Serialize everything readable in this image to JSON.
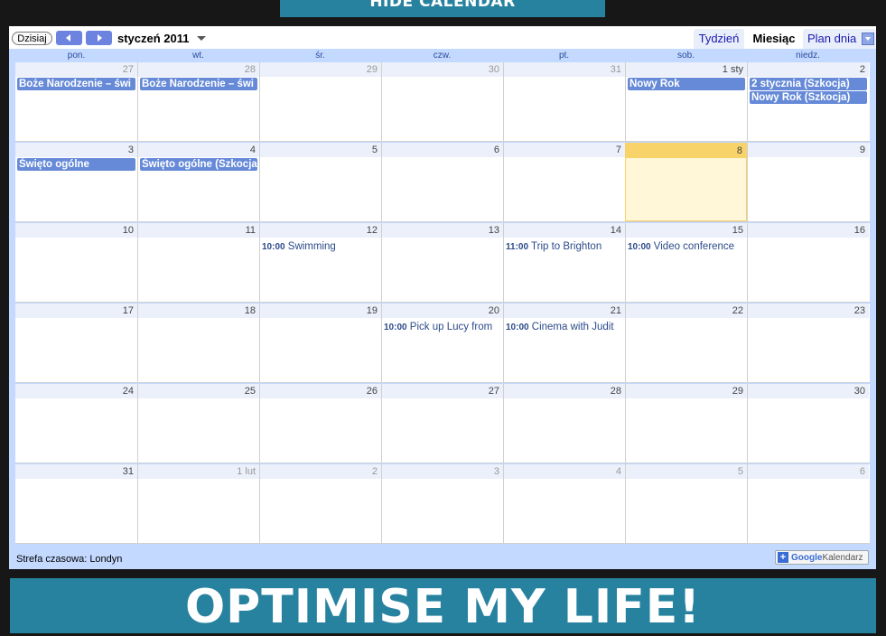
{
  "top_button": {
    "label": "HIDE CALENDAR"
  },
  "toolbar": {
    "today_label": "Dzisiaj",
    "month_title": "styczeń 2011",
    "tabs": {
      "week": "Tydzień",
      "month": "Miesiąc",
      "agenda": "Plan dnia"
    }
  },
  "weekdays": [
    "pon.",
    "wt.",
    "śr.",
    "czw.",
    "pt.",
    "sob.",
    "niedz."
  ],
  "weeks": [
    {
      "days": [
        {
          "label": "27",
          "other": true,
          "events": [
            {
              "kind": "allday",
              "title": "Boże Narodzenie – świ"
            }
          ]
        },
        {
          "label": "28",
          "other": true,
          "events": [
            {
              "kind": "allday",
              "title": "Boże Narodzenie – świ"
            }
          ]
        },
        {
          "label": "29",
          "other": true,
          "events": []
        },
        {
          "label": "30",
          "other": true,
          "events": []
        },
        {
          "label": "31",
          "other": true,
          "events": []
        },
        {
          "label": "1 sty",
          "other": false,
          "events": [
            {
              "kind": "allday",
              "title": "Nowy Rok"
            }
          ]
        },
        {
          "label": "2",
          "other": false,
          "events": [
            {
              "kind": "allday",
              "title": "2 stycznia (Szkocja)"
            },
            {
              "kind": "allday",
              "title": "Nowy Rok (Szkocja)"
            }
          ]
        }
      ]
    },
    {
      "days": [
        {
          "label": "3",
          "events": [
            {
              "kind": "allday",
              "title": "Święto ogólne"
            }
          ]
        },
        {
          "label": "4",
          "events": [
            {
              "kind": "allday",
              "title": "Święto ogólne (Szkocja)"
            }
          ]
        },
        {
          "label": "5",
          "events": []
        },
        {
          "label": "6",
          "events": []
        },
        {
          "label": "7",
          "events": []
        },
        {
          "label": "8",
          "today": true,
          "events": []
        },
        {
          "label": "9",
          "events": []
        }
      ]
    },
    {
      "days": [
        {
          "label": "10",
          "events": []
        },
        {
          "label": "11",
          "events": []
        },
        {
          "label": "12",
          "events": [
            {
              "kind": "timed",
              "time": "10:00",
              "title": "Swimming"
            }
          ]
        },
        {
          "label": "13",
          "events": []
        },
        {
          "label": "14",
          "events": [
            {
              "kind": "timed",
              "time": "11:00",
              "title": "Trip to Brighton"
            }
          ]
        },
        {
          "label": "15",
          "events": [
            {
              "kind": "timed",
              "time": "10:00",
              "title": "Video conference"
            }
          ]
        },
        {
          "label": "16",
          "events": []
        }
      ]
    },
    {
      "days": [
        {
          "label": "17",
          "events": []
        },
        {
          "label": "18",
          "events": []
        },
        {
          "label": "19",
          "events": []
        },
        {
          "label": "20",
          "events": [
            {
              "kind": "timed",
              "time": "10:00",
              "title": "Pick up Lucy from"
            }
          ]
        },
        {
          "label": "21",
          "events": [
            {
              "kind": "timed",
              "time": "10:00",
              "title": "Cinema with Judit"
            }
          ]
        },
        {
          "label": "22",
          "events": []
        },
        {
          "label": "23",
          "events": []
        }
      ]
    },
    {
      "days": [
        {
          "label": "24",
          "events": []
        },
        {
          "label": "25",
          "events": []
        },
        {
          "label": "26",
          "events": []
        },
        {
          "label": "27",
          "events": []
        },
        {
          "label": "28",
          "events": []
        },
        {
          "label": "29",
          "events": []
        },
        {
          "label": "30",
          "events": []
        }
      ]
    },
    {
      "days": [
        {
          "label": "31",
          "events": []
        },
        {
          "label": "1 lut",
          "other": true,
          "events": []
        },
        {
          "label": "2",
          "other": true,
          "events": []
        },
        {
          "label": "3",
          "other": true,
          "events": []
        },
        {
          "label": "4",
          "other": true,
          "events": []
        },
        {
          "label": "5",
          "other": true,
          "events": []
        },
        {
          "label": "6",
          "other": true,
          "events": []
        }
      ]
    }
  ],
  "footer": {
    "timezone": "Strefa czasowa: Londyn",
    "badge_google": "Google",
    "badge_text": "Kalendarz"
  },
  "banner": {
    "text": "OPTIMISE MY LIFE!"
  },
  "colors": {
    "banner": "#27829f",
    "today": "#f8d36a",
    "event_bg": "#668ad8"
  }
}
